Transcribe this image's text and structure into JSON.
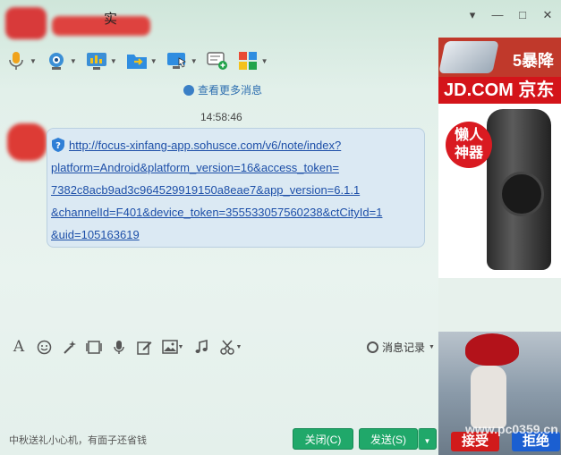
{
  "window": {
    "title": "实",
    "controls": [
      "▾",
      "—",
      "□",
      "✕"
    ]
  },
  "toolbar": {
    "items": [
      {
        "name": "voice-call-icon"
      },
      {
        "name": "video-call-icon"
      },
      {
        "name": "screen-share-icon"
      },
      {
        "name": "file-transfer-icon"
      },
      {
        "name": "remote-desktop-icon"
      },
      {
        "name": "create-group-icon"
      },
      {
        "name": "apps-icon"
      }
    ]
  },
  "chat": {
    "more_messages": "查看更多消息",
    "timestamp": "14:58:46",
    "message_lines": [
      "http://focus-xinfang-app.sohusce.com/v6/note/index?",
      "platform=Android&platform_version=16&access_token=",
      "7382c8acb9ad3c964529919150a8eae7&app_version=6.1.1",
      "&channelId=F401&device_token=355533057560238&ctCityId=1",
      "&uid=105163619"
    ]
  },
  "input_toolbar": {
    "history_label": "消息记录"
  },
  "footer": {
    "tip": "中秋送礼小心机，有面子还省钱",
    "close_label": "关闭(C)",
    "send_label": "发送(S)"
  },
  "ad": {
    "top_text": "5暴降",
    "jd_brand": "JD.COM 京东",
    "badge_line1": "懒人",
    "badge_line2": "神器",
    "accept_label": "接受",
    "reject_label": "拒绝",
    "watermark": "www.pc0359.cn"
  },
  "colors": {
    "send_green": "#20a86a",
    "link_blue": "#1d4fa8",
    "jd_red": "#d4141a"
  }
}
